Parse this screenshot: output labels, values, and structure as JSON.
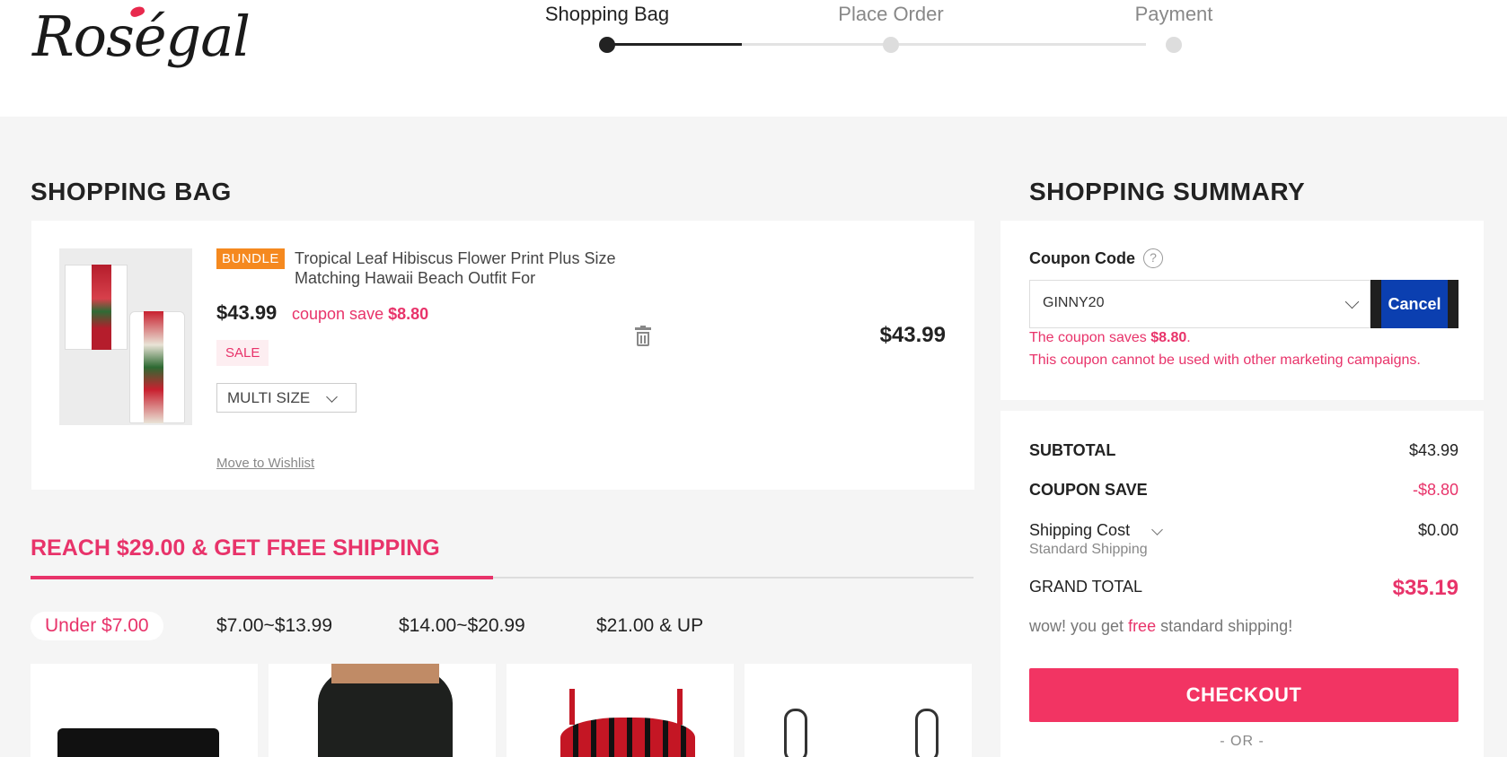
{
  "header": {
    "logo_text": "Roségal",
    "steps": [
      {
        "label": "Shopping Bag",
        "active": true
      },
      {
        "label": "Place Order",
        "active": false
      },
      {
        "label": "Payment",
        "active": false
      }
    ]
  },
  "cart": {
    "title": "SHOPPING BAG",
    "item": {
      "bundle_label": "BUNDLE",
      "name": "Tropical Leaf Hibiscus Flower Print Plus Size Matching Hawaii Beach Outfit For",
      "price": "$43.99",
      "coupon_save_text": "coupon save ",
      "coupon_save_amount": "$8.80",
      "sale_badge": "SALE",
      "size": "MULTI SIZE",
      "line_total": "$43.99",
      "wishlist_link": "Move to Wishlist"
    }
  },
  "free_shipping": {
    "title": "REACH $29.00 & GET FREE SHIPPING",
    "progress": 0.49,
    "tabs": [
      {
        "label": "Under $7.00",
        "active": true
      },
      {
        "label": "$7.00~$13.99",
        "active": false
      },
      {
        "label": "$14.00~$20.99",
        "active": false
      },
      {
        "label": "$21.00 & UP",
        "active": false
      }
    ]
  },
  "summary": {
    "title": "SHOPPING SUMMARY",
    "coupon": {
      "label": "Coupon Code",
      "help_icon": "?",
      "value": "GINNY20",
      "cancel_label": "Cancel",
      "msg1_prefix": "The coupon saves ",
      "msg1_amount": "$8.80",
      "msg1_suffix": ".",
      "msg2": "This coupon cannot be used with other marketing campaigns."
    },
    "subtotal_label": "SUBTOTAL",
    "subtotal_value": "$43.99",
    "coupon_save_label": "COUPON SAVE",
    "coupon_save_value": "-$8.80",
    "shipping_label": "Shipping Cost",
    "shipping_value": "$0.00",
    "shipping_method": "Standard Shipping",
    "grand_total_label": "GRAND TOTAL",
    "grand_total_value": "$35.19",
    "free_note_prefix": "wow! you get ",
    "free_note_highlight": "free",
    "free_note_suffix": " standard shipping!",
    "checkout_label": "CHECKOUT",
    "or_label": "- OR -"
  },
  "colors": {
    "accent": "#e8336a",
    "checkout": "#f23463",
    "bundle_tag": "#f5891f",
    "cancel_button": "#0b3fb0"
  }
}
